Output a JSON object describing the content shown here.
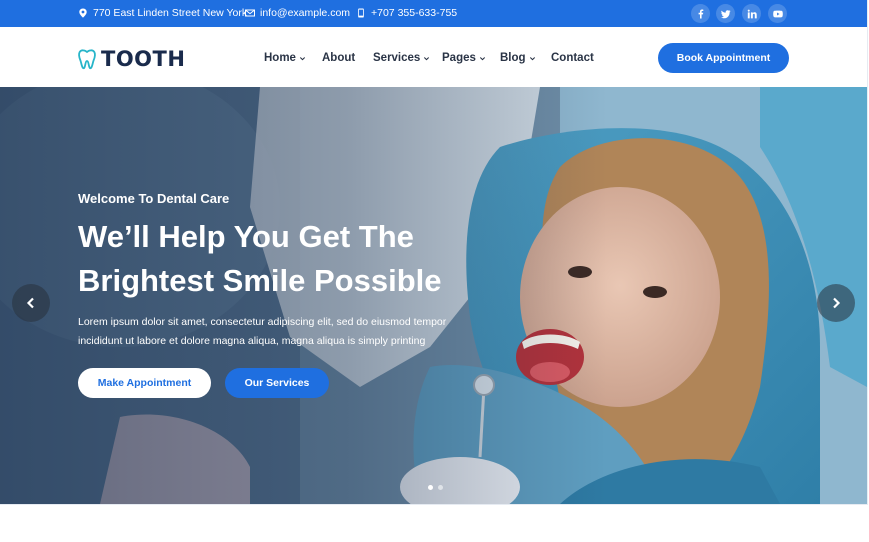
{
  "topbar": {
    "address": "770 East Linden Street New York",
    "email": "info@example.com",
    "phone": "+707 355-633-755",
    "socials": [
      "facebook-icon",
      "twitter-icon",
      "linkedin-icon",
      "youtube-icon"
    ]
  },
  "brand": {
    "name": "TOOTH",
    "accent": "#1f6fe0",
    "logo_color": "#27b5c9"
  },
  "nav": {
    "items": [
      {
        "label": "Home",
        "dropdown": true
      },
      {
        "label": "About",
        "dropdown": false
      },
      {
        "label": "Services",
        "dropdown": true
      },
      {
        "label": "Pages",
        "dropdown": true
      },
      {
        "label": "Blog",
        "dropdown": true
      },
      {
        "label": "Contact",
        "dropdown": false
      }
    ],
    "cta_label": "Book Appointment"
  },
  "hero": {
    "subtitle": "Welcome To Dental Care",
    "title_line1": "We’ll Help You Get The",
    "title_line2": "Brightest Smile Possible",
    "description_line1": "Lorem ipsum dolor sit amet, consectetur adipiscing elit, sed do eiusmod tempor",
    "description_line2": "incididunt ut labore et dolore magna aliqua, magna aliqua is simply printing",
    "primary_button": "Make Appointment",
    "secondary_button": "Our Services",
    "slider": {
      "total_slides": 2,
      "active_slide": 1
    }
  }
}
